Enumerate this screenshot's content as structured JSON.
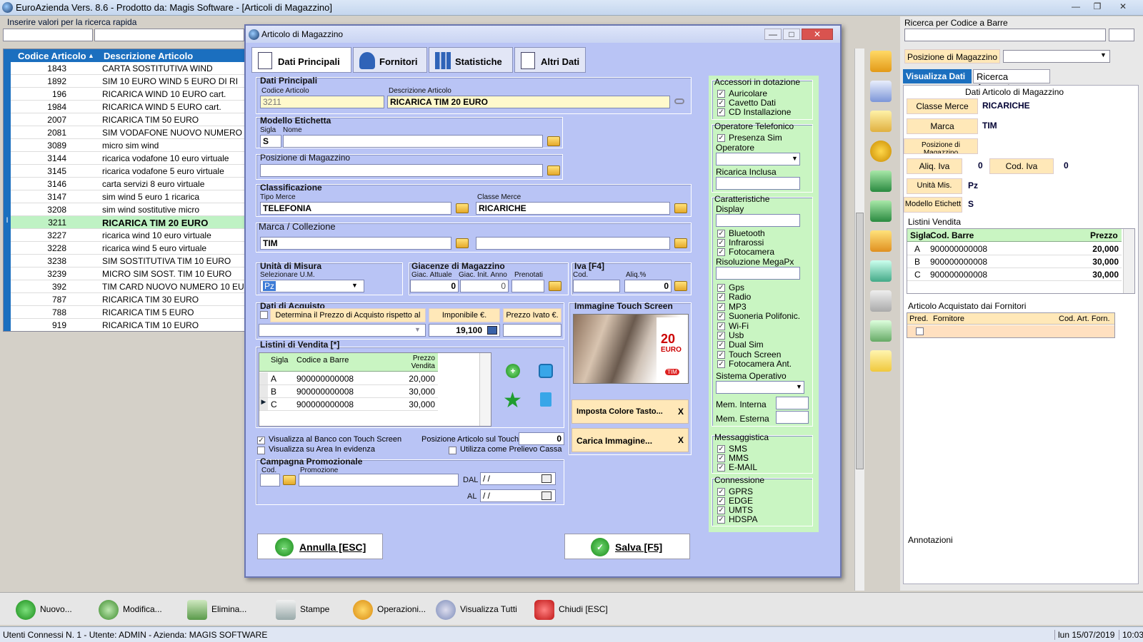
{
  "window": {
    "title": "EuroAzienda Vers. 8.6 - Prodotto da: Magis Software - [Articoli di Magazzino]"
  },
  "quick_search": {
    "label": "Inserire valori per la ricerca rapida"
  },
  "grid": {
    "headers": [
      "Codice Articolo",
      "Descrizione Articolo"
    ],
    "rows": [
      {
        "code": "1843",
        "desc": "CARTA SOSTITUTIVA WIND"
      },
      {
        "code": "1892",
        "desc": "SIM 10 EURO WIND 5 EURO DI RI"
      },
      {
        "code": "196",
        "desc": "RICARICA WIND 10 EURO cart."
      },
      {
        "code": "1984",
        "desc": "RICARICA WIND 5 EURO cart."
      },
      {
        "code": "2007",
        "desc": "RICARICA TIM 50 EURO"
      },
      {
        "code": "2081",
        "desc": "SIM VODAFONE NUOVO NUMERO"
      },
      {
        "code": "3089",
        "desc": "micro sim wind"
      },
      {
        "code": "3144",
        "desc": "ricarica vodafone 10 euro virtuale"
      },
      {
        "code": "3145",
        "desc": "ricarica vodafone 5 euro virtuale"
      },
      {
        "code": "3146",
        "desc": "carta servizi 8 euro virtuale"
      },
      {
        "code": "3147",
        "desc": "sim wind 5 euro 1 ricarica"
      },
      {
        "code": "3208",
        "desc": "sim wind sostitutive micro"
      },
      {
        "code": "3211",
        "desc": "RICARICA TIM 20 EURO"
      },
      {
        "code": "3227",
        "desc": "ricarica wind 10 euro virtuale"
      },
      {
        "code": "3228",
        "desc": "ricarica wind 5 euro virtuale"
      },
      {
        "code": "3238",
        "desc": "SIM SOSTITUTIVA TIM 10 EURO"
      },
      {
        "code": "3239",
        "desc": "MICRO SIM SOST. TIM 10 EURO"
      },
      {
        "code": "392",
        "desc": "TIM CARD NUOVO NUMERO 10 EU"
      },
      {
        "code": "787",
        "desc": "RICARICA TIM 30 EURO"
      },
      {
        "code": "788",
        "desc": "RICARICA TIM 5 EURO"
      },
      {
        "code": "919",
        "desc": "RICARICA TIM 10 EURO"
      }
    ],
    "selected_index": 12
  },
  "dialog": {
    "title": "Articolo di Magazzino",
    "tabs": [
      "Dati Principali",
      "Fornitori",
      "Statistiche",
      "Altri Dati"
    ],
    "dati_principali": {
      "title": "Dati Principali",
      "codice_label": "Codice Articolo",
      "codice": "3211",
      "descr_label": "Descrizione Articolo",
      "descr": "RICARICA TIM 20 EURO"
    },
    "modello": {
      "title": "Modello Etichetta",
      "sigla_label": "Sigla",
      "nome_label": "Nome",
      "sigla": "S",
      "nome": ""
    },
    "posizione": {
      "title": "Posizione di Magazzino"
    },
    "classificazione": {
      "title": "Classificazione",
      "tipo_label": "Tipo Merce",
      "tipo": "TELEFONIA",
      "classe_label": "Classe Merce",
      "classe": "RICARICHE"
    },
    "marca": {
      "title": "Marca / Collezione",
      "value": "TIM"
    },
    "um": {
      "title": "Unità di Misura",
      "sub": "Selezionare U.M.",
      "value": "Pz"
    },
    "giacenze": {
      "title": "Giacenze di Magazzino",
      "labels": [
        "Giac. Attuale",
        "Giac. Init. Anno",
        "Prenotati"
      ],
      "values": [
        "0",
        "0",
        ""
      ]
    },
    "iva": {
      "title": "Iva [F4]",
      "cod_label": "Cod.",
      "aliq_label": "Aliq.%",
      "aliq": "0"
    },
    "acquisto": {
      "title": "Dati di Acquisto",
      "check_label": "Determina il Prezzo di Acquisto rispetto al",
      "imponibile_label": "Imponibile €.",
      "ivato_label": "Prezzo Ivato €.",
      "imponibile": "19,100"
    },
    "touch": {
      "title": "Immagine Touch Screen",
      "img_amount": "20",
      "img_unit": "EURO",
      "img_brand": "TIM",
      "btn_colore": "Imposta Colore Tasto...",
      "btn_immagine": "Carica Immagine...",
      "x": "X"
    },
    "listini": {
      "title": "Listini di Vendita [*]",
      "headers": [
        "Sigla",
        "Codice a Barre",
        "Prezzo Vendita"
      ],
      "rows": [
        {
          "sigla": "A",
          "barre": "900000000008",
          "prezzo": "20,000"
        },
        {
          "sigla": "B",
          "barre": "900000000008",
          "prezzo": "30,000"
        },
        {
          "sigla": "C",
          "barre": "900000000008",
          "prezzo": "30,000"
        }
      ]
    },
    "opts": {
      "banco": "Visualizza al Banco con Touch Screen",
      "area": "Visualizza su Area In evidenza",
      "pos_label": "Posizione Articolo sul Touch",
      "pos": "0",
      "prelievo": "Utilizza come Prelievo Cassa"
    },
    "campagna": {
      "title": "Campagna Promozionale",
      "cod_label": "Cod.",
      "promo_label": "Promozione",
      "dal": "DAL",
      "al": "AL",
      "date": "/ /"
    },
    "annulla": "Annulla [ESC]",
    "salva": "Salva [F5]",
    "accessori": {
      "title": "Accessori in dotazione",
      "items": [
        "Auricolare",
        "Cavetto Dati",
        "CD Installazione"
      ]
    },
    "operatore": {
      "title": "Operatore Telefonico",
      "presenza": "Presenza Sim",
      "operatore": "Operatore",
      "ricarica": "Ricarica Inclusa"
    },
    "caratteristiche": {
      "title": "Caratteristiche",
      "display": "Display",
      "items1": [
        "Bluetooth",
        "Infrarossi",
        "Fotocamera"
      ],
      "risoluzione": "Risoluzione MegaPx",
      "items2": [
        "Gps",
        "Radio",
        "MP3",
        "Suoneria Polifonic.",
        "Wi-Fi",
        "Usb",
        "Dual Sim",
        "Touch Screen",
        "Fotocamera Ant."
      ],
      "sistema": "Sistema Operativo",
      "mem_int": "Mem. Interna",
      "mem_est": "Mem. Esterna"
    },
    "messaggistica": {
      "title": "Messaggistica",
      "items": [
        "SMS",
        "MMS",
        "E-MAIL"
      ]
    },
    "connessione": {
      "title": "Connessione",
      "items": [
        "GPRS",
        "EDGE",
        "UMTS",
        "HDSPA"
      ]
    }
  },
  "right": {
    "barcode_label": "Ricerca per Codice a Barre",
    "pos_label": "Posizione di Magazzino",
    "tabs": [
      "Visualizza Dati",
      "Ricerca Avanzata"
    ],
    "section": "Dati Articolo di Magazzino",
    "classe_label": "Classe Merce",
    "classe": "RICARICHE",
    "marca_label": "Marca",
    "marca": "TIM",
    "pos2_label": "Posizione di Magazzino",
    "aliq_label": "Aliq. Iva",
    "aliq": "0",
    "codiva_label": "Cod. Iva",
    "codiva": "0",
    "um_label": "Unità Mis.",
    "um": "Pz",
    "modello_label": "Modello Etichett",
    "modello": "S",
    "listini_title": "Listini Vendita",
    "listini_headers": [
      "Sigla",
      "Cod. Barre",
      "Prezzo"
    ],
    "listini": [
      {
        "s": "A",
        "b": "900000000008",
        "p": "20,000"
      },
      {
        "s": "B",
        "b": "900000000008",
        "p": "30,000"
      },
      {
        "s": "C",
        "b": "900000000008",
        "p": "30,000"
      }
    ],
    "fornitori_title": "Articolo Acquistato dai Fornitori",
    "forn_headers": [
      "Pred.",
      "Fornitore",
      "Cod. Art. Forn."
    ],
    "annotazioni": "Annotazioni"
  },
  "toolbar": [
    "Nuovo...",
    "Modifica...",
    "Elimina...",
    "Stampe",
    "Operazioni...",
    "Visualizza Tutti",
    "Chiudi [ESC]"
  ],
  "status": {
    "left": "Utenti Connessi N. 1 - Utente: ADMIN - Azienda: MAGIS SOFTWARE",
    "date": "lun 15/07/2019",
    "time": "10:03"
  },
  "colors": {
    "header_blue": "#1b6fbf",
    "dialog_bg": "#b9c4f5",
    "yellow_field": "#fff9cc",
    "green_header": "#c9f5c2"
  }
}
